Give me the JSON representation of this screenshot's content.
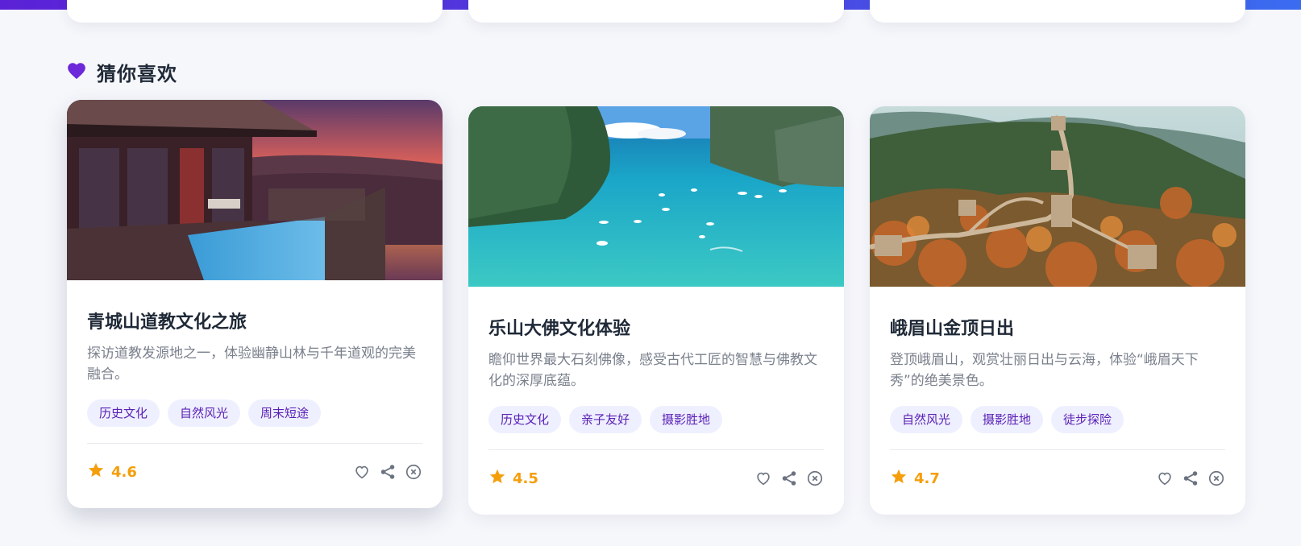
{
  "section": {
    "title": "猜你喜欢"
  },
  "colors": {
    "accent": "#6d28d9",
    "star": "#f59e0b",
    "tag_bg": "#eef0ff",
    "tag_text": "#5b21b6"
  },
  "cards": [
    {
      "title": "青城山道教文化之旅",
      "description": "探访道教发源地之一，体验幽静山林与千年道观的完美融合。",
      "tags": [
        "历史文化",
        "自然风光",
        "周末短途"
      ],
      "rating": "4.6",
      "image_subject": "sunset-villa-pool-photo"
    },
    {
      "title": "乐山大佛文化体验",
      "description": "瞻仰世界最大石刻佛像，感受古代工匠的智慧与佛教文化的深厚底蕴。",
      "tags": [
        "历史文化",
        "亲子友好",
        "摄影胜地"
      ],
      "rating": "4.5",
      "image_subject": "turquoise-bay-cliffs-photo"
    },
    {
      "title": "峨眉山金顶日出",
      "description": "登顶峨眉山，观赏壮丽日出与云海，体验“峨眉天下秀”的绝美景色。",
      "tags": [
        "自然风光",
        "摄影胜地",
        "徒步探险"
      ],
      "rating": "4.7",
      "image_subject": "great-wall-autumn-photo"
    }
  ],
  "icons": {
    "section": "heart-icon",
    "rating": "star-icon",
    "like": "heart-outline-icon",
    "share": "share-icon",
    "dismiss": "close-circle-icon"
  }
}
